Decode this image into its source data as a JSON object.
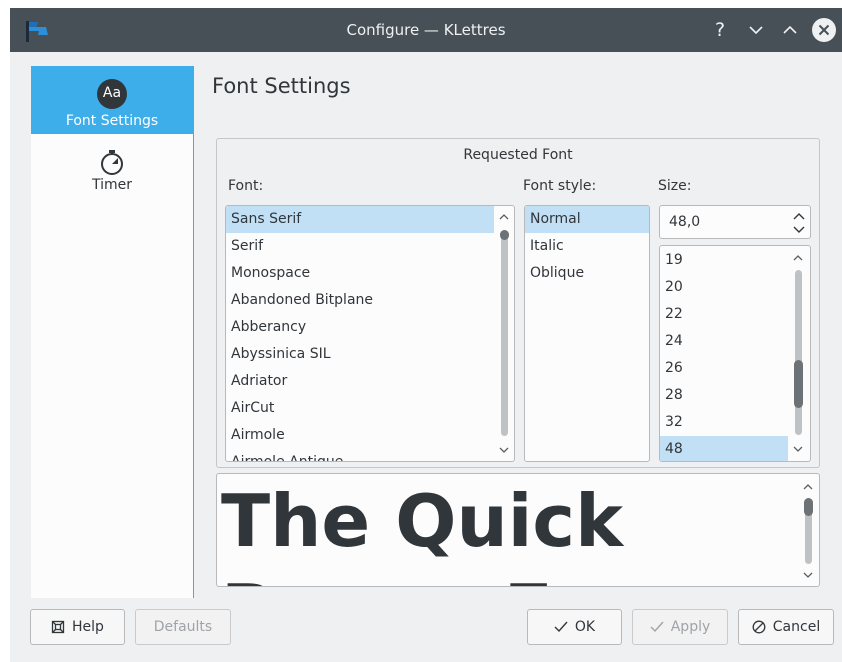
{
  "window": {
    "title": "Configure — KLettres"
  },
  "titlebar": {
    "icons": [
      "app-flag-icon",
      "help-icon",
      "minimize-icon",
      "maximize-icon",
      "close-icon"
    ],
    "help_glyph": "?"
  },
  "sidebar": {
    "items": [
      {
        "label": "Font Settings",
        "icon": "font-aa-icon",
        "icon_text": "Aa",
        "active": true
      },
      {
        "label": "Timer",
        "icon": "stopwatch-icon",
        "active": false
      }
    ]
  },
  "page": {
    "title": "Font Settings"
  },
  "font_chooser": {
    "group_title": "Requested Font",
    "font_label": "Font:",
    "style_label": "Font style:",
    "size_label": "Size:",
    "fonts": [
      "Sans Serif",
      "Serif",
      "Monospace",
      "Abandoned Bitplane",
      "Abberancy",
      "Abyssinica SIL",
      "Adriator",
      "AirCut",
      "Airmole",
      "Airmole Antique"
    ],
    "selected_font": "Sans Serif",
    "styles": [
      "Normal",
      "Italic",
      "Oblique"
    ],
    "selected_style": "Normal",
    "size_value": "48,0",
    "sizes": [
      "19",
      "20",
      "22",
      "24",
      "26",
      "28",
      "32",
      "48"
    ],
    "selected_size": "48"
  },
  "preview": {
    "line1": "The Quick",
    "line2": "Brown Fox"
  },
  "buttons": {
    "help": "Help",
    "defaults": "Defaults",
    "ok": "OK",
    "apply": "Apply",
    "cancel": "Cancel"
  },
  "colors": {
    "accent": "#3daee9",
    "titlebar": "#475057",
    "selection": "#c2e0f5",
    "window_bg": "#eff0f1"
  }
}
